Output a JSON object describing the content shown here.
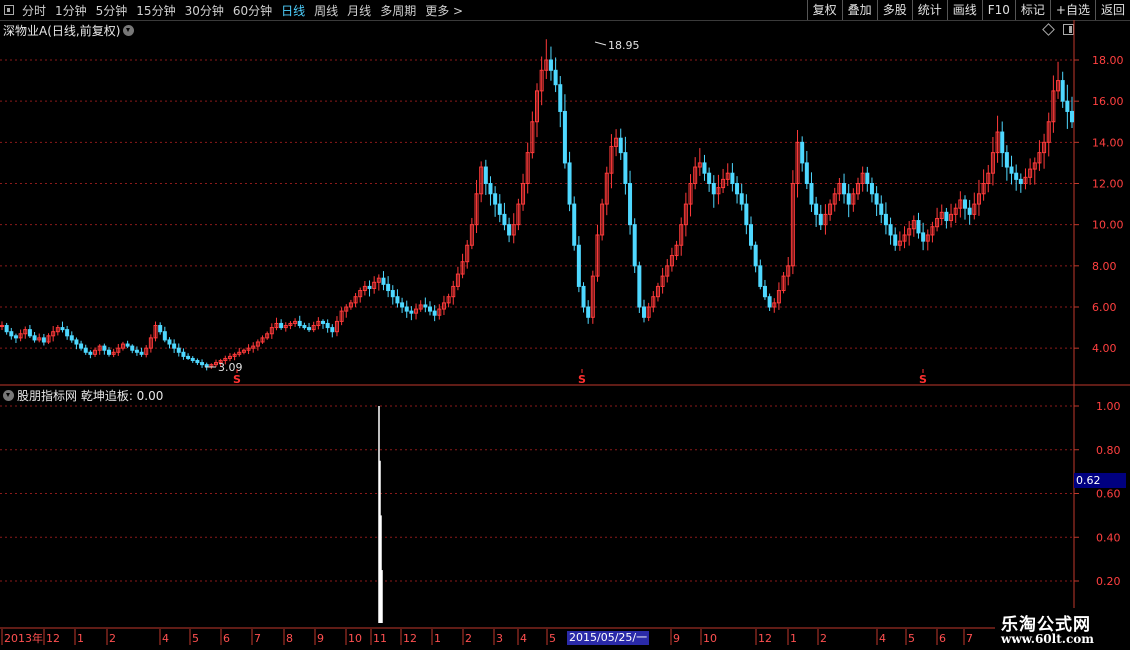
{
  "toolbar": {
    "periods": [
      "分时",
      "1分钟",
      "5分钟",
      "15分钟",
      "30分钟",
      "60分钟",
      "日线",
      "周线",
      "月线",
      "多周期",
      "更多 >"
    ],
    "active_period": "日线",
    "actions": [
      "复权",
      "叠加",
      "多股",
      "统计",
      "画线",
      "F10",
      "标记",
      "+自选",
      "返回"
    ]
  },
  "main_chart": {
    "title": "深物业A(日线,前复权)",
    "high_label": "18.95",
    "low_label": "3.09",
    "signal_marker": "S",
    "y_ticks": [
      "18.00",
      "16.00",
      "14.00",
      "12.00",
      "10.00",
      "8.00",
      "6.00",
      "4.00"
    ]
  },
  "indicator": {
    "title": "股朋指标网 乾坤追板: 0.00",
    "y_ticks": [
      "1.00",
      "0.80",
      "0.60",
      "0.40",
      "0.20"
    ],
    "cursor_value": "0.62"
  },
  "date_axis": {
    "labels": [
      "2013年",
      "12",
      "1",
      "2",
      "4",
      "5",
      "6",
      "7",
      "8",
      "9",
      "10",
      "11",
      "12",
      "1",
      "2",
      "3",
      "4",
      "5",
      "9",
      "10",
      "12",
      "1",
      "2",
      "4",
      "5",
      "6",
      "7"
    ],
    "highlight": "2015/05/25/一"
  },
  "logo": {
    "line1": "乐淘公式网",
    "line2": "www.60lt.com"
  },
  "colors": {
    "up": "#ff3a3a",
    "down": "#4fd8ff",
    "grid": "#8b1a1a",
    "axis": "#c0392b",
    "active": "#4fd1ff"
  },
  "chart_data": {
    "type": "candlestick",
    "series": [
      {
        "values": [
          5.1,
          4.8,
          4.6,
          4.5,
          4.7,
          4.9,
          4.6,
          4.4,
          4.5,
          4.3,
          4.6,
          4.8,
          5.0,
          4.9,
          4.6,
          4.4,
          4.2,
          4.0,
          3.8,
          3.7,
          3.9,
          4.1,
          3.9,
          3.7,
          3.8,
          4.0,
          4.2,
          4.1,
          3.9,
          3.8,
          3.7,
          4.0,
          4.5,
          5.1,
          4.8,
          4.4,
          4.2,
          4.0,
          3.8,
          3.6,
          3.5,
          3.4,
          3.3,
          3.2,
          3.1,
          3.2,
          3.3,
          3.4,
          3.5,
          3.6,
          3.7,
          3.8,
          3.9,
          4.0,
          4.1,
          4.3,
          4.5,
          4.7,
          5.0,
          5.2,
          5.0,
          5.1,
          5.2,
          5.3,
          5.1,
          5.0,
          4.9,
          5.1,
          5.3,
          5.2,
          5.0,
          4.8,
          5.3,
          5.8,
          6.0,
          6.2,
          6.5,
          6.8,
          7.0,
          6.9,
          7.2,
          7.4,
          7.1,
          6.8,
          6.5,
          6.2,
          6.0,
          5.8,
          5.7,
          5.9,
          6.1,
          6.0,
          5.8,
          5.6,
          5.9,
          6.2,
          6.5,
          7.0,
          7.6,
          8.2,
          9.0,
          10.0,
          11.5,
          12.8,
          12.0,
          11.5,
          11.0,
          10.5,
          10.0,
          9.5,
          10.0,
          11.0,
          12.0,
          13.5,
          15.0,
          16.5,
          17.5,
          18.0,
          17.5,
          16.8,
          15.5,
          13.0,
          11.0,
          9.0,
          7.0,
          6.0,
          5.5,
          7.5,
          9.5,
          11.0,
          12.5,
          13.8,
          14.2,
          13.5,
          12.0,
          10.0,
          8.0,
          6.0,
          5.5,
          6.0,
          6.5,
          7.0,
          7.5,
          8.0,
          8.5,
          9.0,
          10.0,
          11.0,
          12.0,
          12.8,
          13.0,
          12.5,
          12.0,
          11.5,
          11.8,
          12.2,
          12.5,
          12.0,
          11.5,
          11.0,
          10.0,
          9.0,
          8.0,
          7.0,
          6.5,
          6.0,
          6.2,
          6.8,
          7.5,
          8.0,
          12.0,
          14.0,
          13.0,
          12.0,
          11.0,
          10.5,
          10.0,
          10.5,
          11.0,
          11.5,
          12.0,
          11.5,
          11.0,
          11.5,
          12.0,
          12.5,
          12.0,
          11.5,
          11.0,
          10.5,
          10.0,
          9.5,
          9.0,
          9.2,
          9.5,
          9.8,
          10.2,
          9.6,
          9.2,
          9.5,
          9.9,
          10.3,
          10.6,
          10.2,
          10.5,
          10.8,
          11.2,
          10.8,
          10.5,
          11.0,
          11.5,
          12.0,
          12.5,
          13.5,
          14.5,
          13.5,
          12.8,
          12.5,
          12.2,
          12.0,
          12.3,
          12.7,
          13.0,
          13.5,
          14.0,
          15.0,
          16.5,
          17.0,
          16.0,
          15.5,
          15.0
        ]
      }
    ],
    "y_range": [
      3.0,
      19.0
    ],
    "indicator_range": [
      0.0,
      1.0
    ],
    "indicator_spikes": [
      {
        "index": 1,
        "value": 1.0
      },
      {
        "index": 2,
        "value": 0.75
      },
      {
        "index": 3,
        "value": 0.5
      },
      {
        "index": 4,
        "value": 0.25
      }
    ],
    "annotations": [
      "18.95",
      "3.09"
    ]
  }
}
